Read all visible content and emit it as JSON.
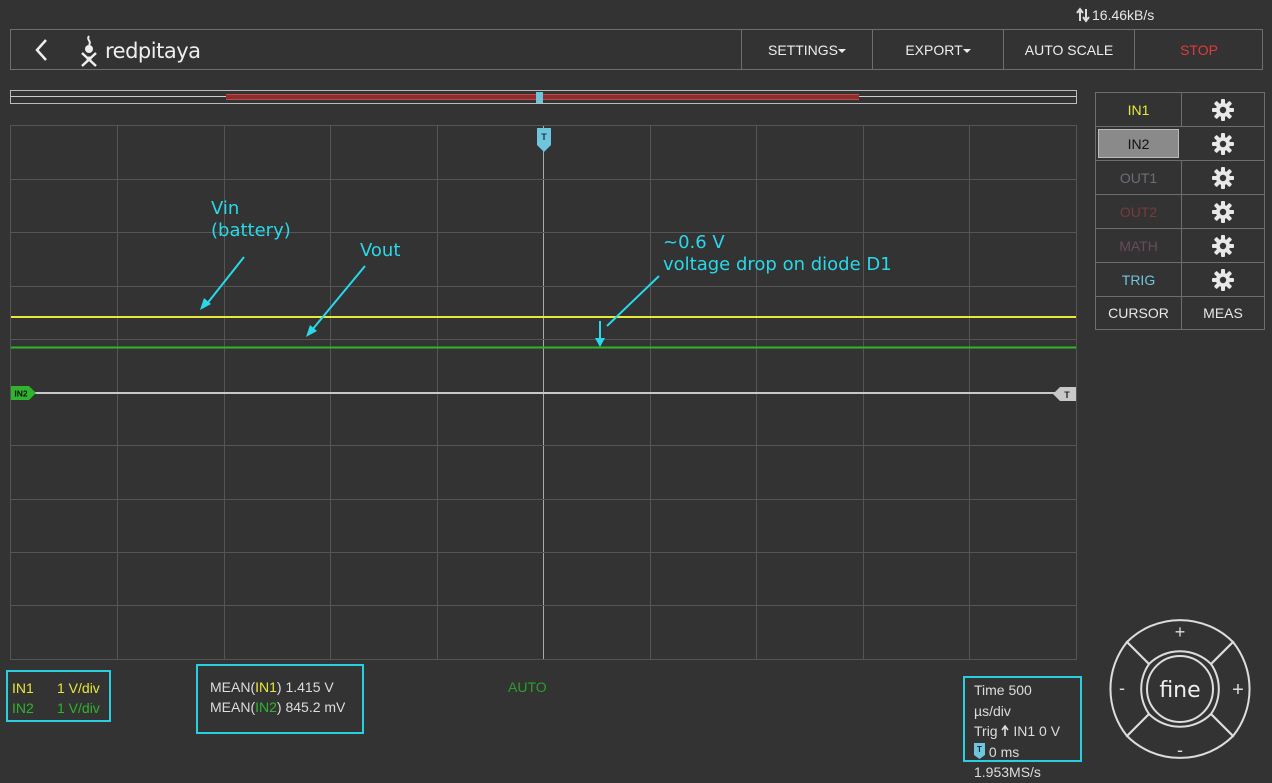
{
  "topbar": {
    "rate": "16.46kB/s"
  },
  "header": {
    "logo_text": "redpitaya",
    "settings_label": "SETTINGS",
    "export_label": "EXPORT",
    "autoscale_label": "AUTO SCALE",
    "stop_label": "STOP"
  },
  "channels": [
    {
      "label": "IN1",
      "color": "#e8e83a"
    },
    {
      "label": "IN2",
      "color": "#111111"
    },
    {
      "label": "OUT1",
      "color": "#6a6f78"
    },
    {
      "label": "OUT2",
      "color": "#7a3a3a"
    },
    {
      "label": "MATH",
      "color": "#6a4a5a"
    },
    {
      "label": "TRIG",
      "color": "#6ec6dc"
    }
  ],
  "tools": {
    "cursor_label": "CURSOR",
    "meas_label": "MEAS"
  },
  "plot": {
    "trigger_marker": "T",
    "in2_marker": "IN2",
    "trig_level_marker": "T",
    "colors": {
      "in1": "#e8e83a",
      "in2": "#2db52d",
      "grid": "#555555",
      "trigger": "#6ec6dc"
    }
  },
  "annotations": {
    "vin_line1": "Vin",
    "vin_line2": "(battery)",
    "vout": "Vout",
    "drop_line1": "~0.6 V",
    "drop_line2": "voltage drop on diode D1"
  },
  "scale": {
    "in1_label": "IN1",
    "in1_value": "1 V/div",
    "in2_label": "IN2",
    "in2_value": "1 V/div"
  },
  "mean": {
    "prefix1": "MEAN(",
    "ch1": "IN1",
    "suffix1": ") 1.415 V",
    "prefix2": "MEAN(",
    "ch2": "IN2",
    "suffix2": ") 845.2 mV"
  },
  "status": {
    "mode": "AUTO"
  },
  "timebase": {
    "time": "Time 500 µs/div",
    "trig_prefix": "Trig",
    "trig_value": "IN1 0 V",
    "trig_marker": "T",
    "offset": "0 ms",
    "rate": "1.953MS/s"
  },
  "wheel": {
    "center_label": "fine",
    "plus": "+",
    "minus": "-"
  }
}
